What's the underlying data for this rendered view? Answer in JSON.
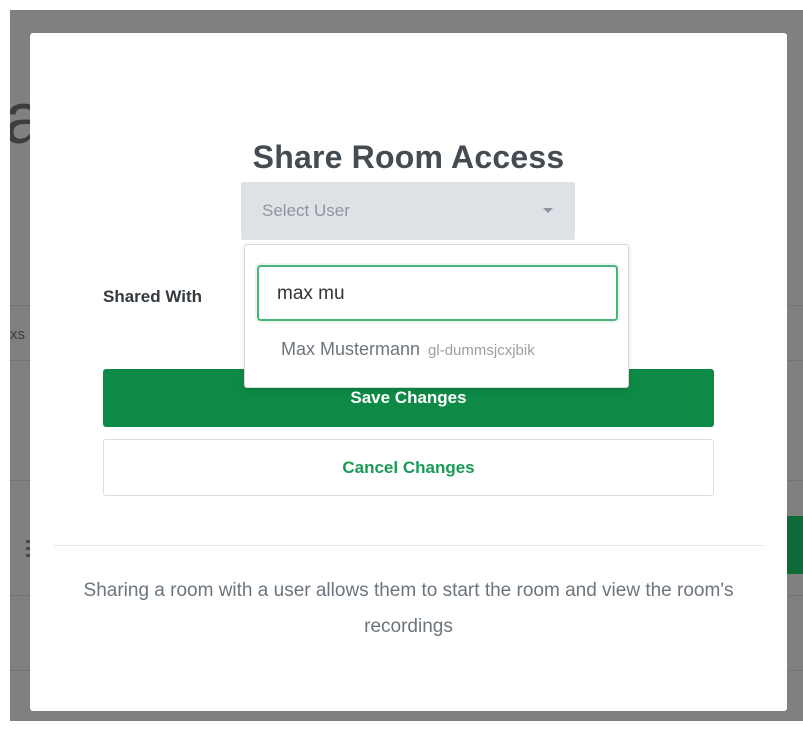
{
  "modal": {
    "title": "Share Room Access",
    "select_user_placeholder": "Select User",
    "search_value": "max mu",
    "options": [
      {
        "name": "Max Mustermann",
        "uid": "gl-dummsjcxjbik"
      }
    ],
    "shared_with_label": "Shared With",
    "save_label": "Save Changes",
    "cancel_label": "Cancel Changes",
    "footer_text": "Sharing a room with a user allows them to start the room and view the room's recordings"
  },
  "background": {
    "partial_heading_letter": "a",
    "partial_text": "xs"
  },
  "colors": {
    "primary_green": "#0d8a45",
    "link_green": "#1a9a57",
    "focus_border": "#48b37a",
    "select_bg": "#dee2e6"
  },
  "icons": {
    "select_caret": "caret-down-icon"
  }
}
